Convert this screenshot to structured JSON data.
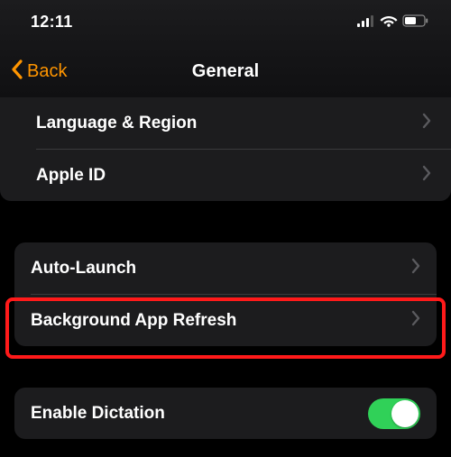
{
  "status": {
    "time": "12:11"
  },
  "nav": {
    "back_label": "Back",
    "title": "General"
  },
  "group1": {
    "items": [
      {
        "label": "Language & Region"
      },
      {
        "label": "Apple ID"
      }
    ]
  },
  "group2": {
    "items": [
      {
        "label": "Auto-Launch"
      },
      {
        "label": "Background App Refresh"
      }
    ]
  },
  "group3": {
    "items": [
      {
        "label": "Enable Dictation",
        "toggle": true
      }
    ]
  },
  "highlighted_row_label": "Background App Refresh"
}
